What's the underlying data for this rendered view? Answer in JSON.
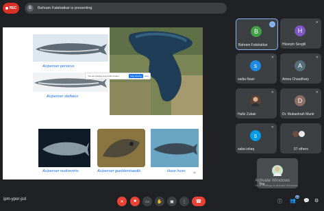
{
  "recording": {
    "label": "REC"
  },
  "presenting_banner": {
    "text": "Bahram Falahatkar is presenting",
    "avatar_letter": "B"
  },
  "slide": {
    "captions": [
      "Acipenser persicus",
      "Acipenser stellatus",
      "Acipenser nudiventris",
      "Acipenser gueldenstaedtii",
      "Huso huso"
    ],
    "share_notice": {
      "text": "You are sharing your entire screen.",
      "stop_label": "Stop sharing",
      "hide_label": "Hide"
    },
    "page_number": "11"
  },
  "participants": [
    {
      "name": "Bahram Falahatkar",
      "initial": "B",
      "color": "#43a047",
      "muted": false,
      "highlight": true
    },
    {
      "name": "Hüseyin Sevgili",
      "initial": "H",
      "color": "#7e57c2",
      "muted": true
    },
    {
      "name": "sadia Nasir",
      "initial": "s",
      "color": "#1e88e5",
      "muted": true
    },
    {
      "name": "Amna Chaudhary",
      "initial": "A",
      "color": "#546e7a",
      "muted": true
    },
    {
      "name": "Hafiz Zubair",
      "initial": "",
      "color": "#5d4037",
      "muted": true,
      "photo": true
    },
    {
      "name": "Dr. Mubashrah Munir",
      "initial": "D",
      "color": "#8d6e63",
      "muted": true
    },
    {
      "name": "saba ishaq",
      "initial": "s",
      "color": "#039be5",
      "muted": true
    },
    {
      "name": "57 others",
      "initial": "",
      "color": "#3c4043",
      "muted": false
    }
  ],
  "self_view": {
    "name": "You"
  },
  "meeting_code": "ipm-ypor-jcd",
  "people_count": "64",
  "windows_watermark": {
    "title": "Activate Windows",
    "subtitle": "Go to Settings to activate Windows."
  },
  "colors": {
    "background": "#202124",
    "tile": "#3c4043",
    "accent": "#8ab4f8",
    "danger": "#ea4335"
  }
}
